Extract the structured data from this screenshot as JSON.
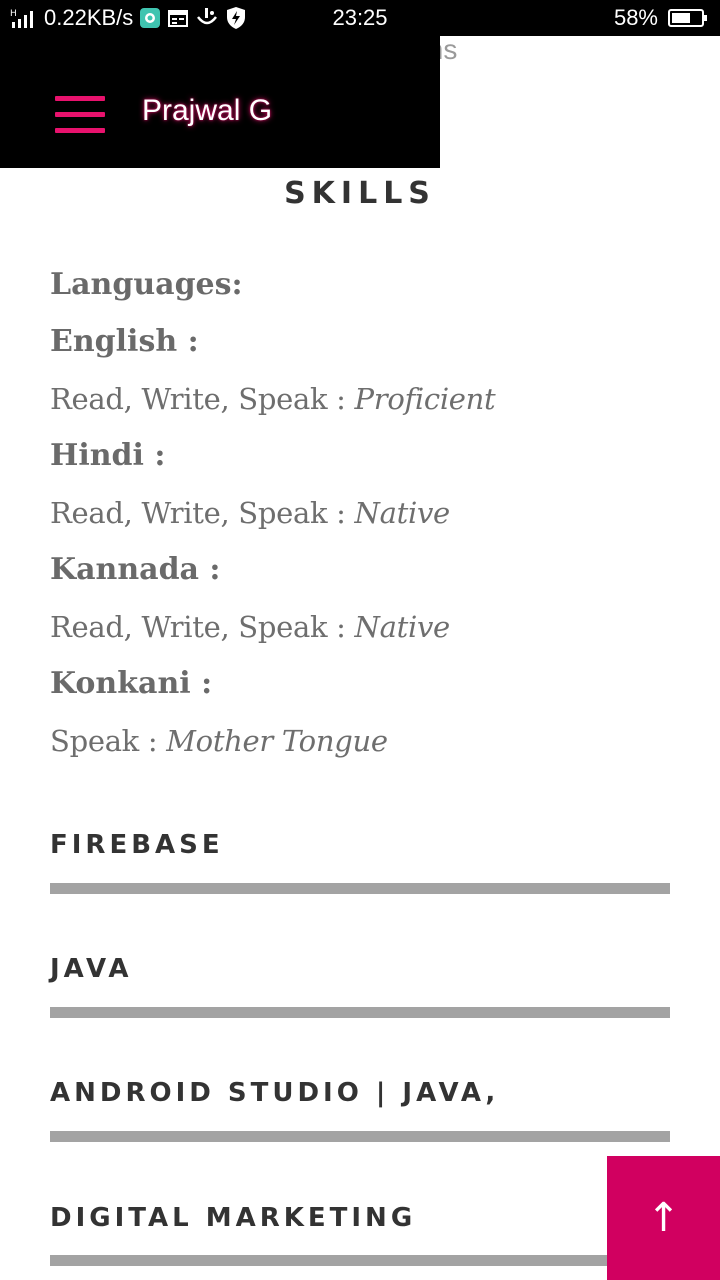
{
  "status_bar": {
    "network_speed": "0.22KB/s",
    "time": "23:25",
    "battery": "58%",
    "icons": [
      "signal-icon",
      "app-notification-icon",
      "calendar-icon",
      "assistant-icon",
      "shield-icon",
      "battery-icon"
    ]
  },
  "header": {
    "title": "Prajwal G",
    "peek_text": "ms",
    "accent_color": "#e8126d"
  },
  "skills": {
    "heading": "SKILLS",
    "languages_label": "Languages:",
    "languages": [
      {
        "name": "English :",
        "abilities": "Read, Write, Speak : ",
        "level": "Proficient"
      },
      {
        "name": "Hindi :",
        "abilities": "Read, Write, Speak : ",
        "level": "Native"
      },
      {
        "name": "Kannada :",
        "abilities": "Read, Write, Speak : ",
        "level": "Native"
      },
      {
        "name": "Konkani :",
        "abilities": "Speak : ",
        "level": "Mother Tongue"
      }
    ],
    "items": [
      {
        "name": "FIREBASE"
      },
      {
        "name": "JAVA"
      },
      {
        "name": "ANDROID STUDIO | JAVA,"
      },
      {
        "name": "DIGITAL MARKETING"
      }
    ]
  },
  "back_to_top": {
    "glyph": "↑",
    "color": "#d10060"
  }
}
